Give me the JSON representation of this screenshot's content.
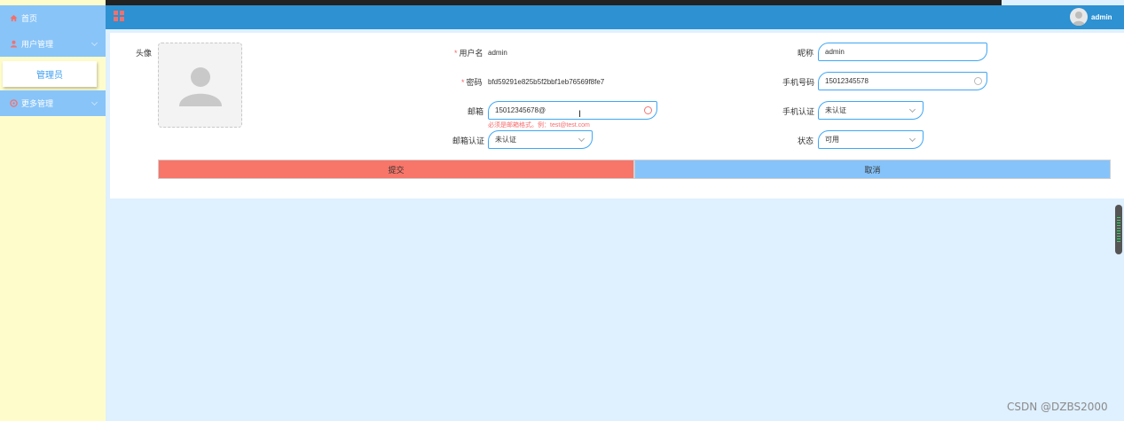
{
  "sidebar": {
    "items": [
      {
        "label": "首页",
        "icon": "home-icon",
        "icon_color": "#f2706c"
      },
      {
        "label": "用户管理",
        "icon": "user-icon",
        "icon_color": "#f2706c"
      },
      {
        "label": "更多管理",
        "icon": "more-icon",
        "icon_color": "#f2706c"
      }
    ],
    "submenu": {
      "label": "管理员"
    }
  },
  "header": {
    "username": "admin",
    "grid_icon": "grid-icon",
    "accent": "#2d91d2"
  },
  "form": {
    "avatar_label": "头像",
    "username": {
      "label": "用户名",
      "required": "*",
      "value": "admin"
    },
    "nickname": {
      "label": "昵称",
      "value": "admin"
    },
    "password": {
      "label": "密码",
      "required": "*",
      "value": "bfd59291e825b5f2bbf1eb76569f8fe7"
    },
    "phone": {
      "label": "手机号码",
      "value": "15012345578"
    },
    "email": {
      "label": "邮箱",
      "value": "15012345678@",
      "error": "必须是邮箱格式。例：test@test.com"
    },
    "phone_verify": {
      "label": "手机认证",
      "value": "未认证"
    },
    "email_verify": {
      "label": "邮箱认证",
      "value": "未认证"
    },
    "status": {
      "label": "状态",
      "value": "可用"
    },
    "submit_label": "提交",
    "cancel_label": "取消"
  },
  "colors": {
    "sidebar_bg": "#fffccb",
    "menu_bg": "#88c4f8",
    "page_bg": "#dff0ff",
    "submit_bg": "#f87569",
    "cancel_bg": "#86c3fa",
    "error": "#f56c6c"
  },
  "watermark": "CSDN @DZBS2000"
}
